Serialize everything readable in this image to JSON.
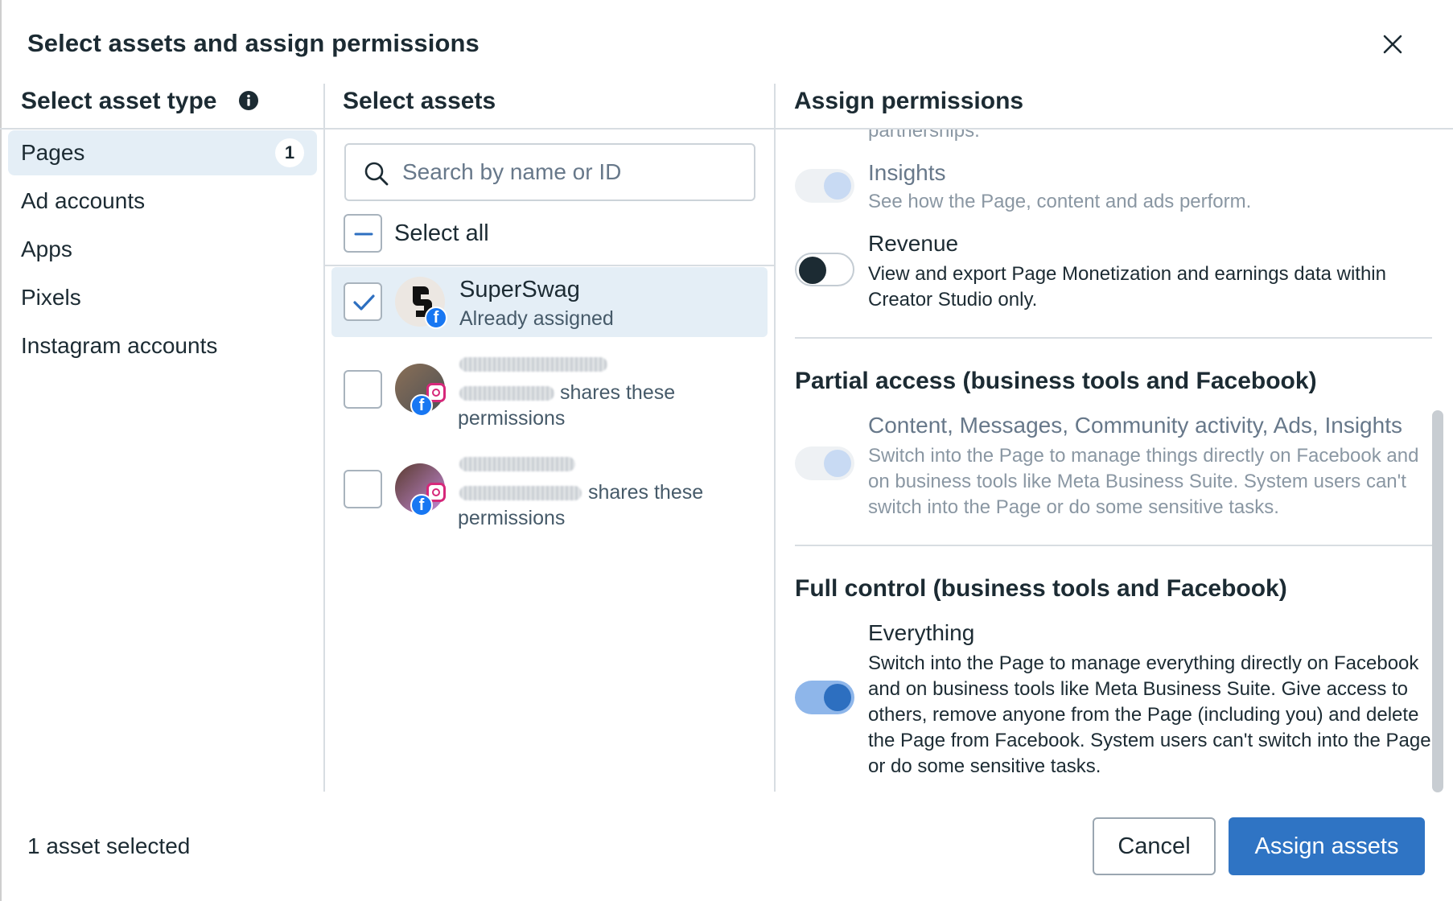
{
  "dialog": {
    "title": "Select assets and assign permissions"
  },
  "asset_types": {
    "heading": "Select asset type",
    "items": [
      {
        "label": "Pages",
        "count": "1",
        "active": true
      },
      {
        "label": "Ad accounts"
      },
      {
        "label": "Apps"
      },
      {
        "label": "Pixels"
      },
      {
        "label": "Instagram accounts"
      }
    ]
  },
  "assets": {
    "heading": "Select assets",
    "search_placeholder": "Search by name or ID",
    "select_all_label": "Select all",
    "items": [
      {
        "name": "SuperSwag",
        "subtitle": "Already assigned",
        "checked": true
      },
      {
        "subtitle_suffix": "shares these",
        "subtitle_line2": "permissions",
        "checked": false
      },
      {
        "subtitle_suffix": "shares these",
        "subtitle_line2": "permissions",
        "checked": false
      }
    ]
  },
  "permissions": {
    "heading": "Assign permissions",
    "clipped_text": "partnerships.",
    "items": [
      {
        "title": "Insights",
        "description": "See how the Page, content and ads perform.",
        "state": "on-disabled"
      },
      {
        "title": "Revenue",
        "description": "View and export Page Monetization and earnings data within Creator Studio only.",
        "state": "off"
      }
    ],
    "partial_access": {
      "title": "Partial access (business tools and Facebook)",
      "item_title": "Content, Messages, Community activity, Ads, Insights",
      "item_description": "Switch into the Page to manage things directly on Facebook and on business tools like Meta Business Suite. System users can't switch into the Page or do some sensitive tasks.",
      "state": "on-disabled"
    },
    "full_control": {
      "title": "Full control (business tools and Facebook)",
      "item_title": "Everything",
      "item_description": "Switch into the Page to manage everything directly on Facebook and on business tools like Meta Business Suite. Give access to others, remove anyone from the Page (including you) and delete the Page from Facebook. System users can't switch into the Page or do some sensitive tasks.",
      "state": "on"
    }
  },
  "footer": {
    "status": "1 asset selected",
    "cancel_label": "Cancel",
    "assign_label": "Assign assets"
  },
  "colors": {
    "primary": "#2f74c4",
    "selected_bg": "#e4eef6",
    "text": "#1c2b33"
  }
}
